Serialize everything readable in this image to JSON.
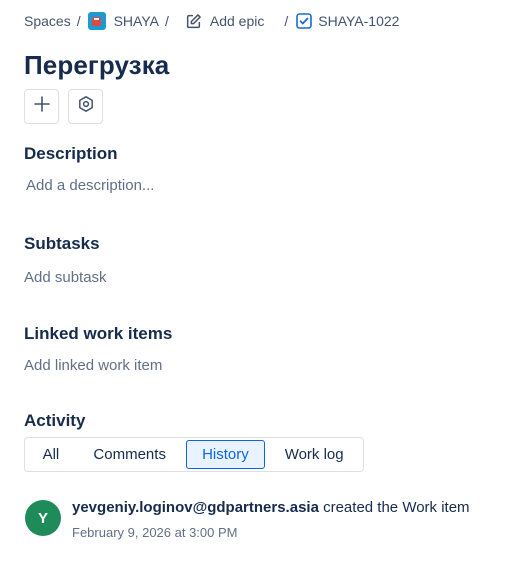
{
  "breadcrumb": {
    "spaces": "Spaces",
    "project": "SHAYA",
    "add_epic": "Add epic",
    "issue_key": "SHAYA-1022",
    "separator": "/"
  },
  "issue": {
    "title": "Перегрузка"
  },
  "description": {
    "heading": "Description",
    "placeholder": "Add a description..."
  },
  "subtasks": {
    "heading": "Subtasks",
    "action": "Add subtask"
  },
  "linked": {
    "heading": "Linked work items",
    "action": "Add linked work item"
  },
  "activity": {
    "heading": "Activity",
    "tabs": [
      "All",
      "Comments",
      "History",
      "Work log"
    ],
    "active_tab": "History",
    "entries": [
      {
        "avatar_initial": "Y",
        "avatar_color": "#1f8a5a",
        "user": "yevgeniy.loginov@gdpartners.asia",
        "action": "created the Work item",
        "date": "February 9, 2026 at 3:00 PM"
      }
    ]
  },
  "colors": {
    "text_primary": "#172b4d",
    "text_subtle": "#626f86",
    "accent": "#0c66e4",
    "accent_bg": "#e9f2ff",
    "border": "#dcdfe4"
  },
  "icons": [
    "space-icon",
    "edit-icon",
    "checkbox-icon",
    "plus-icon",
    "settings-icon"
  ]
}
